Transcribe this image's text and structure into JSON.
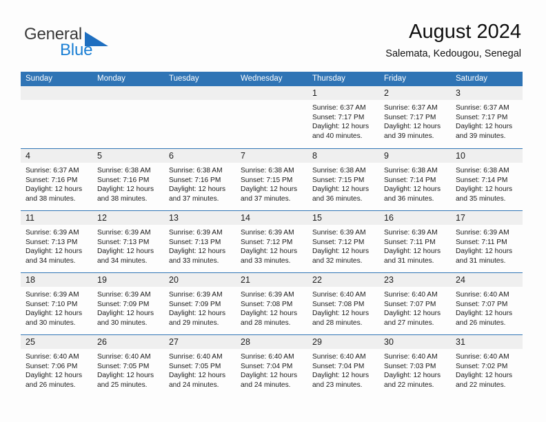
{
  "brand": {
    "line1": "General",
    "line2": "Blue",
    "triangle_icon": "brand-triangle-icon",
    "blue": "#1b7fd4"
  },
  "header": {
    "title": "August 2024",
    "subtitle": "Salemata, Kedougou, Senegal"
  },
  "theme": {
    "header_blue": "#2f74b5",
    "daynum_band": "#efefef",
    "page_background": "#fdfdfd",
    "text": "#1a1a1a"
  },
  "weekdays": [
    "Sunday",
    "Monday",
    "Tuesday",
    "Wednesday",
    "Thursday",
    "Friday",
    "Saturday"
  ],
  "weeks": [
    [
      {
        "day": ""
      },
      {
        "day": ""
      },
      {
        "day": ""
      },
      {
        "day": ""
      },
      {
        "day": "1",
        "sunrise": "Sunrise: 6:37 AM",
        "sunset": "Sunset: 7:17 PM",
        "daylight": "Daylight: 12 hours and 40 minutes."
      },
      {
        "day": "2",
        "sunrise": "Sunrise: 6:37 AM",
        "sunset": "Sunset: 7:17 PM",
        "daylight": "Daylight: 12 hours and 39 minutes."
      },
      {
        "day": "3",
        "sunrise": "Sunrise: 6:37 AM",
        "sunset": "Sunset: 7:17 PM",
        "daylight": "Daylight: 12 hours and 39 minutes."
      }
    ],
    [
      {
        "day": "4",
        "sunrise": "Sunrise: 6:37 AM",
        "sunset": "Sunset: 7:16 PM",
        "daylight": "Daylight: 12 hours and 38 minutes."
      },
      {
        "day": "5",
        "sunrise": "Sunrise: 6:38 AM",
        "sunset": "Sunset: 7:16 PM",
        "daylight": "Daylight: 12 hours and 38 minutes."
      },
      {
        "day": "6",
        "sunrise": "Sunrise: 6:38 AM",
        "sunset": "Sunset: 7:16 PM",
        "daylight": "Daylight: 12 hours and 37 minutes."
      },
      {
        "day": "7",
        "sunrise": "Sunrise: 6:38 AM",
        "sunset": "Sunset: 7:15 PM",
        "daylight": "Daylight: 12 hours and 37 minutes."
      },
      {
        "day": "8",
        "sunrise": "Sunrise: 6:38 AM",
        "sunset": "Sunset: 7:15 PM",
        "daylight": "Daylight: 12 hours and 36 minutes."
      },
      {
        "day": "9",
        "sunrise": "Sunrise: 6:38 AM",
        "sunset": "Sunset: 7:14 PM",
        "daylight": "Daylight: 12 hours and 36 minutes."
      },
      {
        "day": "10",
        "sunrise": "Sunrise: 6:38 AM",
        "sunset": "Sunset: 7:14 PM",
        "daylight": "Daylight: 12 hours and 35 minutes."
      }
    ],
    [
      {
        "day": "11",
        "sunrise": "Sunrise: 6:39 AM",
        "sunset": "Sunset: 7:13 PM",
        "daylight": "Daylight: 12 hours and 34 minutes."
      },
      {
        "day": "12",
        "sunrise": "Sunrise: 6:39 AM",
        "sunset": "Sunset: 7:13 PM",
        "daylight": "Daylight: 12 hours and 34 minutes."
      },
      {
        "day": "13",
        "sunrise": "Sunrise: 6:39 AM",
        "sunset": "Sunset: 7:13 PM",
        "daylight": "Daylight: 12 hours and 33 minutes."
      },
      {
        "day": "14",
        "sunrise": "Sunrise: 6:39 AM",
        "sunset": "Sunset: 7:12 PM",
        "daylight": "Daylight: 12 hours and 33 minutes."
      },
      {
        "day": "15",
        "sunrise": "Sunrise: 6:39 AM",
        "sunset": "Sunset: 7:12 PM",
        "daylight": "Daylight: 12 hours and 32 minutes."
      },
      {
        "day": "16",
        "sunrise": "Sunrise: 6:39 AM",
        "sunset": "Sunset: 7:11 PM",
        "daylight": "Daylight: 12 hours and 31 minutes."
      },
      {
        "day": "17",
        "sunrise": "Sunrise: 6:39 AM",
        "sunset": "Sunset: 7:11 PM",
        "daylight": "Daylight: 12 hours and 31 minutes."
      }
    ],
    [
      {
        "day": "18",
        "sunrise": "Sunrise: 6:39 AM",
        "sunset": "Sunset: 7:10 PM",
        "daylight": "Daylight: 12 hours and 30 minutes."
      },
      {
        "day": "19",
        "sunrise": "Sunrise: 6:39 AM",
        "sunset": "Sunset: 7:09 PM",
        "daylight": "Daylight: 12 hours and 30 minutes."
      },
      {
        "day": "20",
        "sunrise": "Sunrise: 6:39 AM",
        "sunset": "Sunset: 7:09 PM",
        "daylight": "Daylight: 12 hours and 29 minutes."
      },
      {
        "day": "21",
        "sunrise": "Sunrise: 6:39 AM",
        "sunset": "Sunset: 7:08 PM",
        "daylight": "Daylight: 12 hours and 28 minutes."
      },
      {
        "day": "22",
        "sunrise": "Sunrise: 6:40 AM",
        "sunset": "Sunset: 7:08 PM",
        "daylight": "Daylight: 12 hours and 28 minutes."
      },
      {
        "day": "23",
        "sunrise": "Sunrise: 6:40 AM",
        "sunset": "Sunset: 7:07 PM",
        "daylight": "Daylight: 12 hours and 27 minutes."
      },
      {
        "day": "24",
        "sunrise": "Sunrise: 6:40 AM",
        "sunset": "Sunset: 7:07 PM",
        "daylight": "Daylight: 12 hours and 26 minutes."
      }
    ],
    [
      {
        "day": "25",
        "sunrise": "Sunrise: 6:40 AM",
        "sunset": "Sunset: 7:06 PM",
        "daylight": "Daylight: 12 hours and 26 minutes."
      },
      {
        "day": "26",
        "sunrise": "Sunrise: 6:40 AM",
        "sunset": "Sunset: 7:05 PM",
        "daylight": "Daylight: 12 hours and 25 minutes."
      },
      {
        "day": "27",
        "sunrise": "Sunrise: 6:40 AM",
        "sunset": "Sunset: 7:05 PM",
        "daylight": "Daylight: 12 hours and 24 minutes."
      },
      {
        "day": "28",
        "sunrise": "Sunrise: 6:40 AM",
        "sunset": "Sunset: 7:04 PM",
        "daylight": "Daylight: 12 hours and 24 minutes."
      },
      {
        "day": "29",
        "sunrise": "Sunrise: 6:40 AM",
        "sunset": "Sunset: 7:04 PM",
        "daylight": "Daylight: 12 hours and 23 minutes."
      },
      {
        "day": "30",
        "sunrise": "Sunrise: 6:40 AM",
        "sunset": "Sunset: 7:03 PM",
        "daylight": "Daylight: 12 hours and 22 minutes."
      },
      {
        "day": "31",
        "sunrise": "Sunrise: 6:40 AM",
        "sunset": "Sunset: 7:02 PM",
        "daylight": "Daylight: 12 hours and 22 minutes."
      }
    ]
  ]
}
